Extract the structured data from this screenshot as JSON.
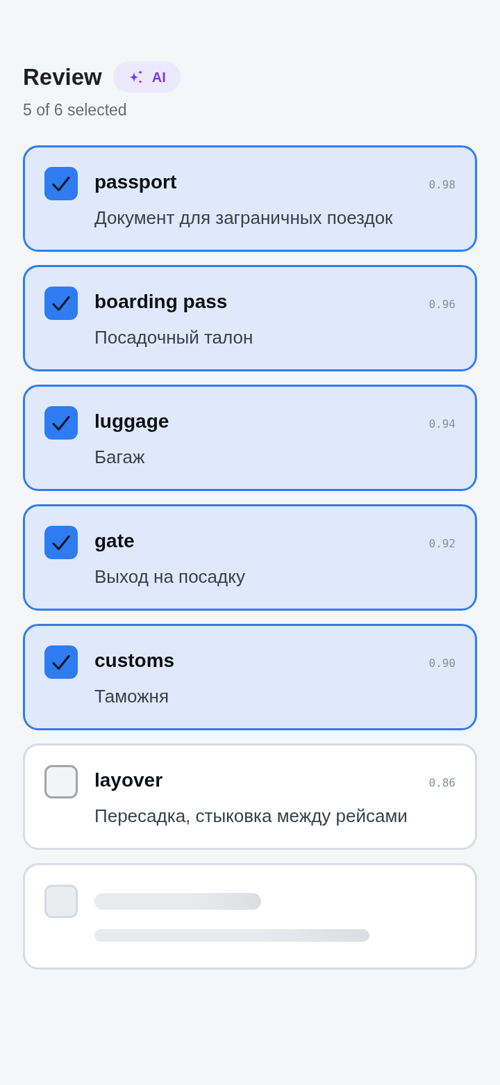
{
  "header": {
    "title": "Review",
    "badge": {
      "label": "AI"
    },
    "subtitle": "5 of 6 selected"
  },
  "items": [
    {
      "kind": "term",
      "term": "passport",
      "score": "0.98",
      "translation": "Документ для заграничных поездок",
      "selected": true
    },
    {
      "kind": "term",
      "term": "boarding pass",
      "score": "0.96",
      "translation": "Посадочный талон",
      "selected": true
    },
    {
      "kind": "term",
      "term": "luggage",
      "score": "0.94",
      "translation": "Багаж",
      "selected": true
    },
    {
      "kind": "term",
      "term": "gate",
      "score": "0.92",
      "translation": "Выход на посадку",
      "selected": true
    },
    {
      "kind": "term",
      "term": "customs",
      "score": "0.90",
      "translation": "Таможня",
      "selected": true
    },
    {
      "kind": "term",
      "term": "layover",
      "score": "0.86",
      "translation": "Пересадка, стыковка между рейсами",
      "selected": false
    },
    {
      "kind": "skeleton"
    }
  ]
}
